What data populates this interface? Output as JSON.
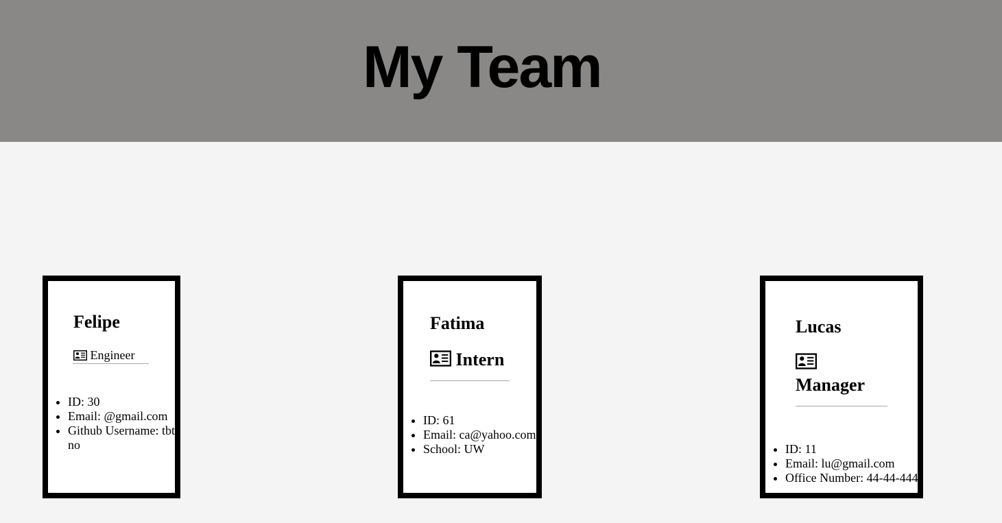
{
  "header": {
    "title": "My Team"
  },
  "icons": {
    "role_icon": "id-card-icon"
  },
  "employees": [
    {
      "name": "Felipe",
      "role": "Engineer",
      "details": [
        {
          "label": "ID: ",
          "value": "30"
        },
        {
          "label": "Email: ",
          "value": "@gmail.com"
        },
        {
          "label": "Github Username: ",
          "value": "tbt"
        },
        {
          "label": "",
          "value": "no"
        }
      ]
    },
    {
      "name": "Fatima",
      "role": "Intern",
      "details": [
        {
          "label": "ID: ",
          "value": "61"
        },
        {
          "label": "Email: ",
          "value": "ca@yahoo.com"
        },
        {
          "label": "School: ",
          "value": "UW"
        }
      ]
    },
    {
      "name": "Lucas",
      "role": "Manager",
      "details": [
        {
          "label": "ID: ",
          "value": "11"
        },
        {
          "label": "Email: ",
          "value": "lu@gmail.com"
        },
        {
          "label": "Office Number: ",
          "value": "44-44-444"
        }
      ]
    }
  ]
}
